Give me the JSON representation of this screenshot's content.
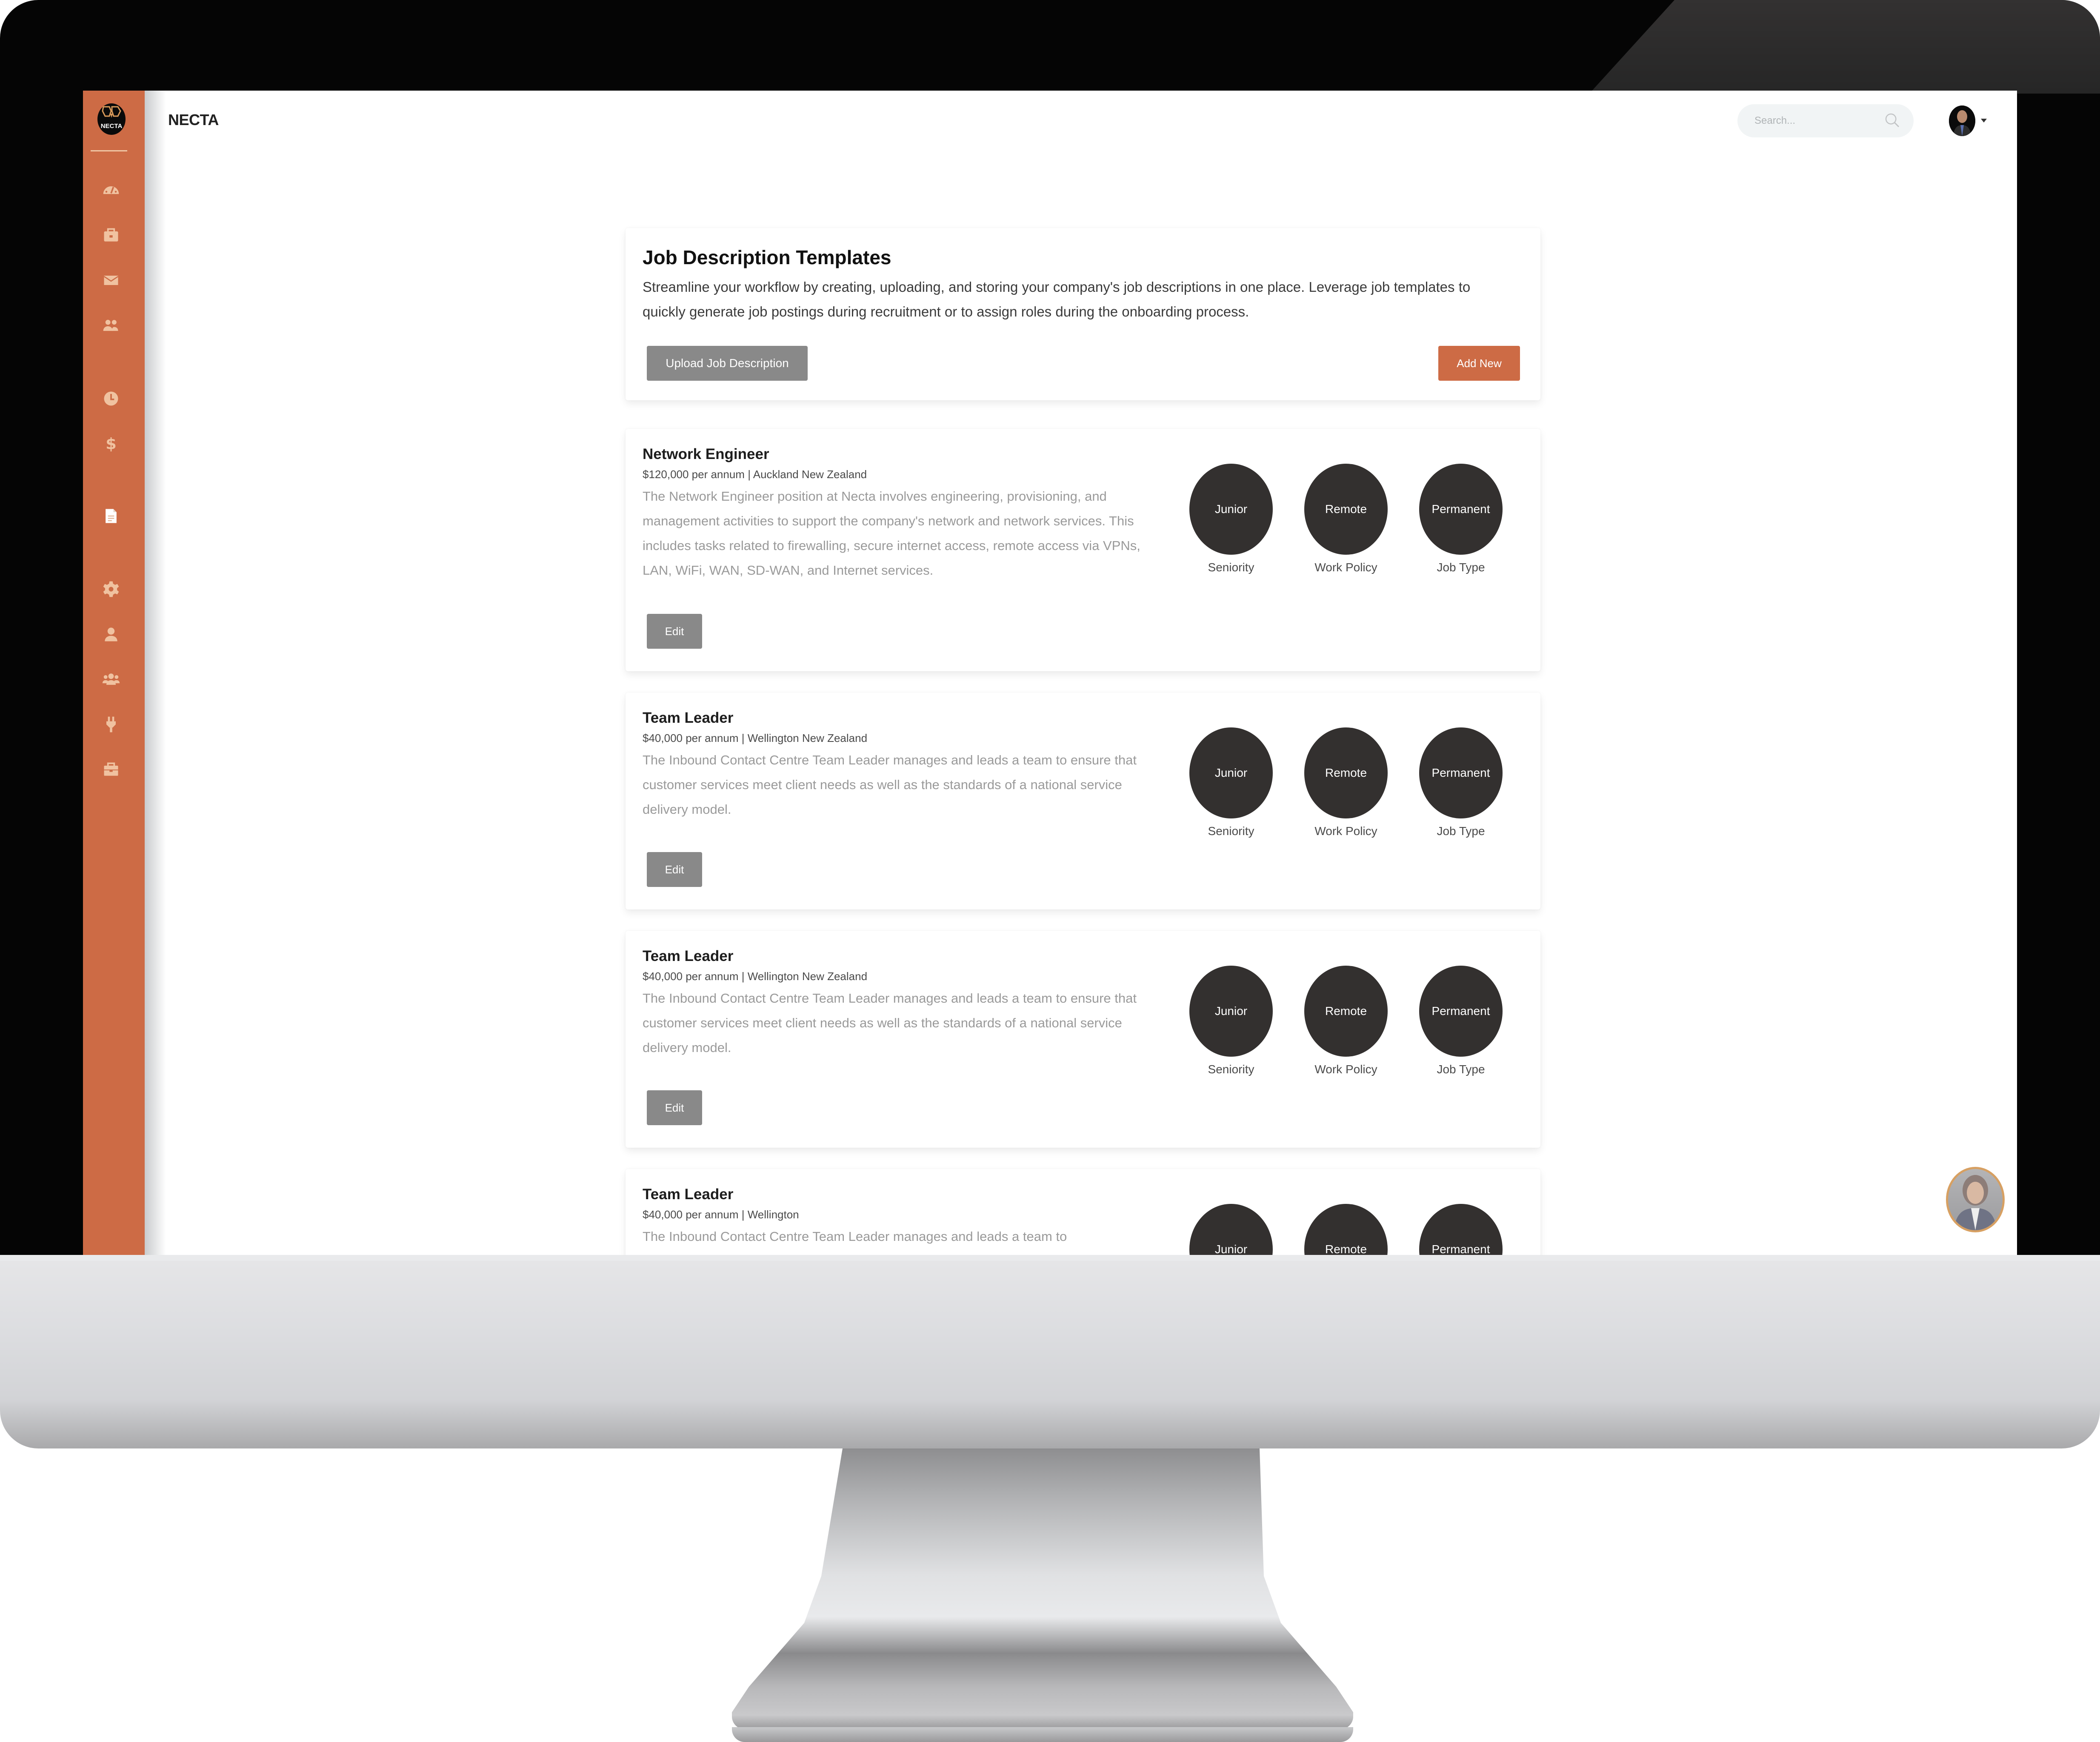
{
  "app": {
    "brand_name": "NECTA",
    "logo_text": "NECTA",
    "accent_color": "#cd6b45",
    "badge_color": "#33302f"
  },
  "sidebar": {
    "items": [
      {
        "icon": "dashboard-gauge-icon",
        "label": "Dashboard"
      },
      {
        "icon": "briefcase-icon",
        "label": "Jobs"
      },
      {
        "icon": "envelope-icon",
        "label": "Messages"
      },
      {
        "icon": "users-icon",
        "label": "Candidates"
      },
      {
        "icon": "clock-icon",
        "label": "Time"
      },
      {
        "icon": "dollar-icon",
        "label": "Payroll"
      },
      {
        "icon": "document-icon",
        "label": "Job Descriptions",
        "active": true
      },
      {
        "icon": "gear-icon",
        "label": "Settings"
      },
      {
        "icon": "user-icon",
        "label": "Profile"
      },
      {
        "icon": "team-icon",
        "label": "Teams"
      },
      {
        "icon": "plug-icon",
        "label": "Integrations"
      },
      {
        "icon": "toolbox-icon",
        "label": "Tools"
      }
    ]
  },
  "header": {
    "search_placeholder": "Search...",
    "search_value": ""
  },
  "intro": {
    "title": "Job Description Templates",
    "description": "Streamline your workflow by creating, uploading, and storing your company's job descriptions in one place. Leverage job templates to quickly generate job postings during recruitment or to assign roles during the onboarding process.",
    "upload_button": "Upload Job Description",
    "add_button": "Add New"
  },
  "badge_labels": {
    "seniority": "Seniority",
    "work_policy": "Work Policy",
    "job_type": "Job Type"
  },
  "edit_label": "Edit",
  "jobs": [
    {
      "title": "Network Engineer",
      "meta": "$120,000 per annum | Auckland New Zealand",
      "description": "The Network Engineer position at Necta involves engineering, provisioning, and management activities to support the company's network and network services. This includes tasks related to firewalling, secure internet access, remote access via VPNs, LAN, WiFi, WAN, SD-WAN, and Internet services.",
      "seniority": "Junior",
      "work_policy": "Remote",
      "job_type": "Permanent"
    },
    {
      "title": "Team Leader",
      "meta": "$40,000 per annum | Wellington New Zealand",
      "description": "The Inbound Contact Centre Team Leader manages and leads a team to ensure that customer services meet client needs as well as the standards of a national service delivery model.",
      "seniority": "Junior",
      "work_policy": "Remote",
      "job_type": "Permanent"
    },
    {
      "title": "Team Leader",
      "meta": "$40,000 per annum | Wellington New Zealand",
      "description": "The Inbound Contact Centre Team Leader manages and leads a team to ensure that customer services meet client needs as well as the standards of a national service delivery model.",
      "seniority": "Junior",
      "work_policy": "Remote",
      "job_type": "Permanent"
    },
    {
      "title": "Team Leader",
      "meta": "$40,000 per annum | Wellington",
      "description": "The Inbound Contact Centre Team Leader manages and leads a team to",
      "seniority": "Junior",
      "work_policy": "Remote",
      "job_type": "Permanent"
    }
  ]
}
